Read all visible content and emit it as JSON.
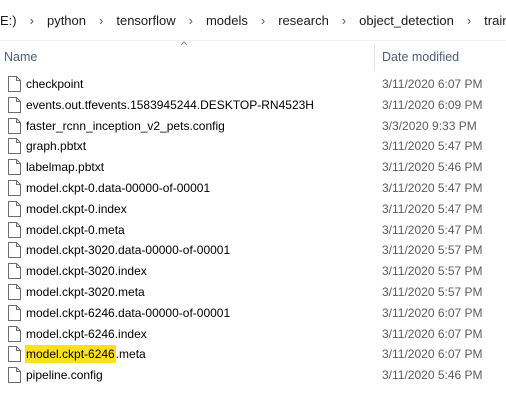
{
  "breadcrumb": [
    "E:)",
    "python",
    "tensorflow",
    "models",
    "research",
    "object_detection",
    "training"
  ],
  "columns": {
    "name": "Name",
    "date_modified": "Date modified"
  },
  "files": [
    {
      "name": "checkpoint",
      "date": "3/11/2020 6:07 PM"
    },
    {
      "name": "events.out.tfevents.1583945244.DESKTOP-RN4523H",
      "date": "3/11/2020 6:09 PM"
    },
    {
      "name": "faster_rcnn_inception_v2_pets.config",
      "date": "3/3/2020 9:33 PM"
    },
    {
      "name": "graph.pbtxt",
      "date": "3/11/2020 5:47 PM"
    },
    {
      "name": "labelmap.pbtxt",
      "date": "3/11/2020 5:46 PM"
    },
    {
      "name": "model.ckpt-0.data-00000-of-00001",
      "date": "3/11/2020 5:47 PM"
    },
    {
      "name": "model.ckpt-0.index",
      "date": "3/11/2020 5:47 PM"
    },
    {
      "name": "model.ckpt-0.meta",
      "date": "3/11/2020 5:47 PM"
    },
    {
      "name": "model.ckpt-3020.data-00000-of-00001",
      "date": "3/11/2020 5:57 PM"
    },
    {
      "name": "model.ckpt-3020.index",
      "date": "3/11/2020 5:57 PM"
    },
    {
      "name": "model.ckpt-3020.meta",
      "date": "3/11/2020 5:57 PM"
    },
    {
      "name": "model.ckpt-6246.data-00000-of-00001",
      "date": "3/11/2020 6:07 PM"
    },
    {
      "name": "model.ckpt-6246.index",
      "date": "3/11/2020 6:07 PM"
    },
    {
      "name": "model.ckpt-6246.meta",
      "date": "3/11/2020 6:07 PM",
      "highlight": "model.ckpt-6246"
    },
    {
      "name": "pipeline.config",
      "date": "3/11/2020 5:46 PM"
    }
  ],
  "highlight_color": "#fde21a",
  "icon": "file-icon"
}
